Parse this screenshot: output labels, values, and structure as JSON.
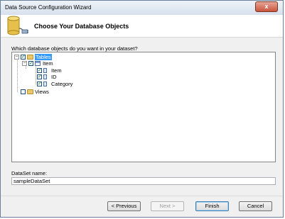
{
  "window": {
    "title": "Data Source Configuration Wizard",
    "close_label": "x"
  },
  "header": {
    "title": "Choose Your Database Objects",
    "icon": "database-connect-icon"
  },
  "prompt": "Which database objects do you want in your dataset?",
  "tree": {
    "tables_label": "Tables",
    "item_table_label": "Item",
    "columns": [
      "Item",
      "ID",
      "Category"
    ],
    "views_label": "Views",
    "tables_checked": true,
    "item_checked": true,
    "columns_checked": [
      true,
      true,
      true
    ],
    "views_checked": false
  },
  "dataset": {
    "label": "DataSet name:",
    "value": "sampleDataSet"
  },
  "buttons": {
    "previous": "< Previous",
    "next": "Next >",
    "finish": "Finish",
    "cancel": "Cancel"
  }
}
